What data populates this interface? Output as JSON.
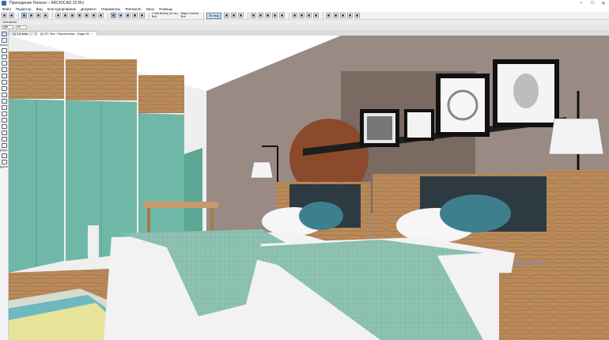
{
  "window": {
    "title": "Приседение Натали – ARCHICAD 23 RU",
    "minimize_glyph": "–",
    "maximize_glyph": "□",
    "close_glyph": "✕"
  },
  "menu": {
    "items": [
      "Файл",
      "Редактор",
      "Вид",
      "Конструирование",
      "Документ",
      "Параметры",
      "Teamwork",
      "Окно",
      "Помощь"
    ]
  },
  "toolbar": {
    "layer_label": "Слой Выбор (по вк.)",
    "layer_value": "Всё",
    "view_label": "Вида Слоина",
    "view_value": "Все",
    "zoom_label": "3D-вид",
    "icons": [
      "undo-icon",
      "redo-icon",
      "arrow-icon",
      "marquee-icon",
      "pan-icon",
      "orbit-icon",
      "zoom-icon"
    ]
  },
  "info": {
    "text": "Основное"
  },
  "subbar": {
    "field_a": "gfd",
    "field_b": "rm"
  },
  "view_tabs": [
    {
      "label": "[1] 1-й этаж",
      "close": "×"
    },
    {
      "label": "[0] 3D / Все / Перспектива – Виды 3D",
      "close": "×"
    }
  ],
  "toolbox": {
    "labels": [
      "Констр.",
      "Докум.",
      "Другие"
    ]
  },
  "scene": {
    "colors": {
      "cabinet": "#6fb8a8",
      "wood": "#b9895a",
      "wall": "#9a8a84",
      "headboard": "#2e3a41",
      "blanket": "#8ec3b3",
      "circle": "#8c4a2c"
    }
  }
}
